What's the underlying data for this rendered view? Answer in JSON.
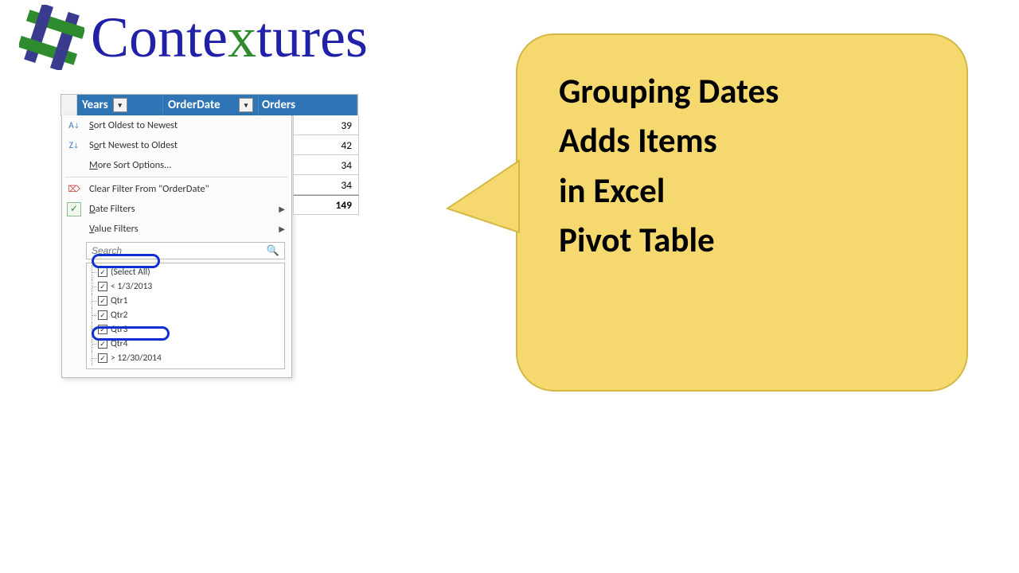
{
  "logo": {
    "text_pre": "Conte",
    "text_x": "x",
    "text_post": "tures"
  },
  "pivot": {
    "headers": {
      "years": "Years",
      "orderdate": "OrderDate",
      "orders": "Orders"
    },
    "values": [
      "39",
      "42",
      "34",
      "34"
    ],
    "total": "149"
  },
  "menu": {
    "sort_asc": "Sort Oldest to Newest",
    "sort_desc": "Sort Newest to Oldest",
    "more_sort": "More Sort Options...",
    "clear_filter": "Clear Filter From \"OrderDate\"",
    "date_filters": "Date Filters",
    "value_filters": "Value Filters",
    "search_placeholder": "Search"
  },
  "tree": {
    "items": [
      "(Select All)",
      "< 1/3/2013",
      "Qtr1",
      "Qtr2",
      "Qtr3",
      "Qtr4",
      "> 12/30/2014"
    ]
  },
  "callout": {
    "line1": "Grouping Dates",
    "line2": "Adds Items",
    "line3": "in Excel",
    "line4": "Pivot Table"
  }
}
